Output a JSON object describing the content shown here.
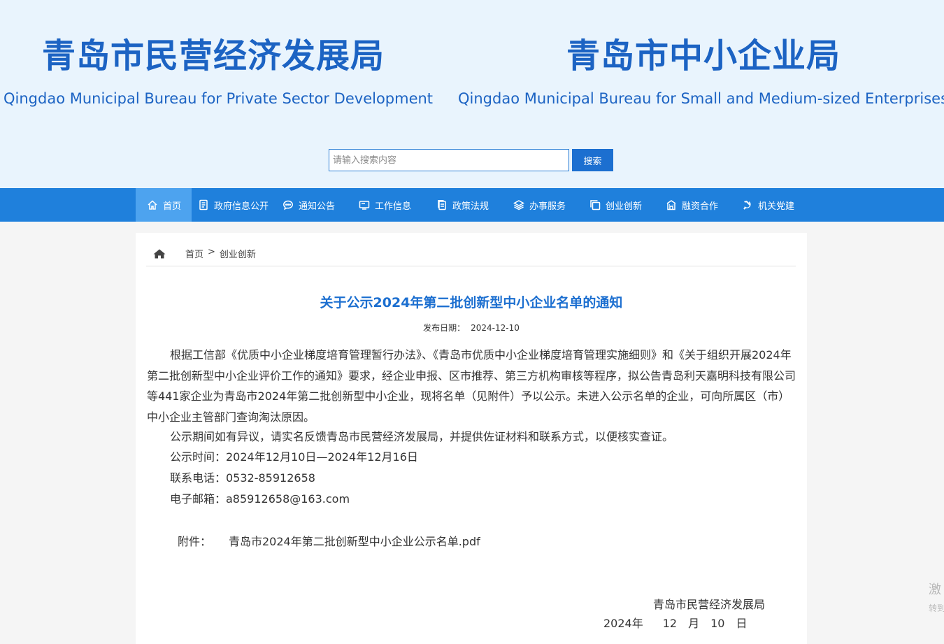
{
  "header": {
    "title_left_cn": "青岛市民营经济发展局",
    "title_left_en": "Qingdao Municipal Bureau for Private Sector Development",
    "title_right_cn": "青岛市中小企业局",
    "title_right_en": "Qingdao Municipal Bureau for Small and Medium-sized Enterprises"
  },
  "search": {
    "placeholder": "请输入搜索内容",
    "button_label": "搜索"
  },
  "nav": {
    "items": [
      {
        "label": "首页",
        "icon": "home-icon"
      },
      {
        "label": "政府信息公开",
        "icon": "document-icon"
      },
      {
        "label": "通知公告",
        "icon": "chat-icon"
      },
      {
        "label": "工作信息",
        "icon": "monitor-icon"
      },
      {
        "label": "政策法规",
        "icon": "file-copy-icon"
      },
      {
        "label": "办事服务",
        "icon": "layers-icon"
      },
      {
        "label": "创业创新",
        "icon": "copy-icon"
      },
      {
        "label": "融资合作",
        "icon": "building-icon"
      },
      {
        "label": "机关党建",
        "icon": "party-emblem-icon"
      }
    ]
  },
  "breadcrumb": {
    "home": "首页",
    "separator": ">",
    "current": "创业创新"
  },
  "article": {
    "title": "关于公示2024年第二批创新型中小企业名单的通知",
    "date_label": "发布日期：",
    "date": "2024-12-10",
    "paragraph1": "根据工信部《优质中小企业梯度培育管理暂行办法》、《青岛市优质中小企业梯度培育管理实施细则》和《关于组织开展2024年第二批创新型中小企业评价工作的通知》要求，经企业申报、区市推荐、第三方机构审核等程序，拟公告青岛利天嘉明科技有限公司等441家企业为青岛市2024年第二批创新型中小企业，现将名单（见附件）予以公示。未进入公示名单的企业，可向所属区（市）中小企业主管部门查询淘汰原因。",
    "paragraph2": "公示期间如有异议，请实名反馈青岛市民营经济发展局，并提供佐证材料和联系方式，以便核实查证。",
    "period": "公示时间：2024年12月10日—2024年12月16日",
    "phone": "联系电话：0532-85912658",
    "email": "电子邮箱：a85912658@163.com",
    "attachment_label": "附件：",
    "attachment_name": "青岛市2024年第二批创新型中小企业公示名单.pdf",
    "signature_org": "青岛市民营经济发展局",
    "signature_year": "2024年",
    "signature_month_num": "12",
    "signature_month": "月",
    "signature_day_num": "10",
    "signature_day": "日"
  },
  "watermark": {
    "line1": "激",
    "line2": "转到"
  },
  "colors": {
    "brand_blue": "#1c63c3",
    "nav_blue": "#1f80dc",
    "nav_active": "#4da3ef",
    "banner_bg": "#e9f4fd"
  }
}
